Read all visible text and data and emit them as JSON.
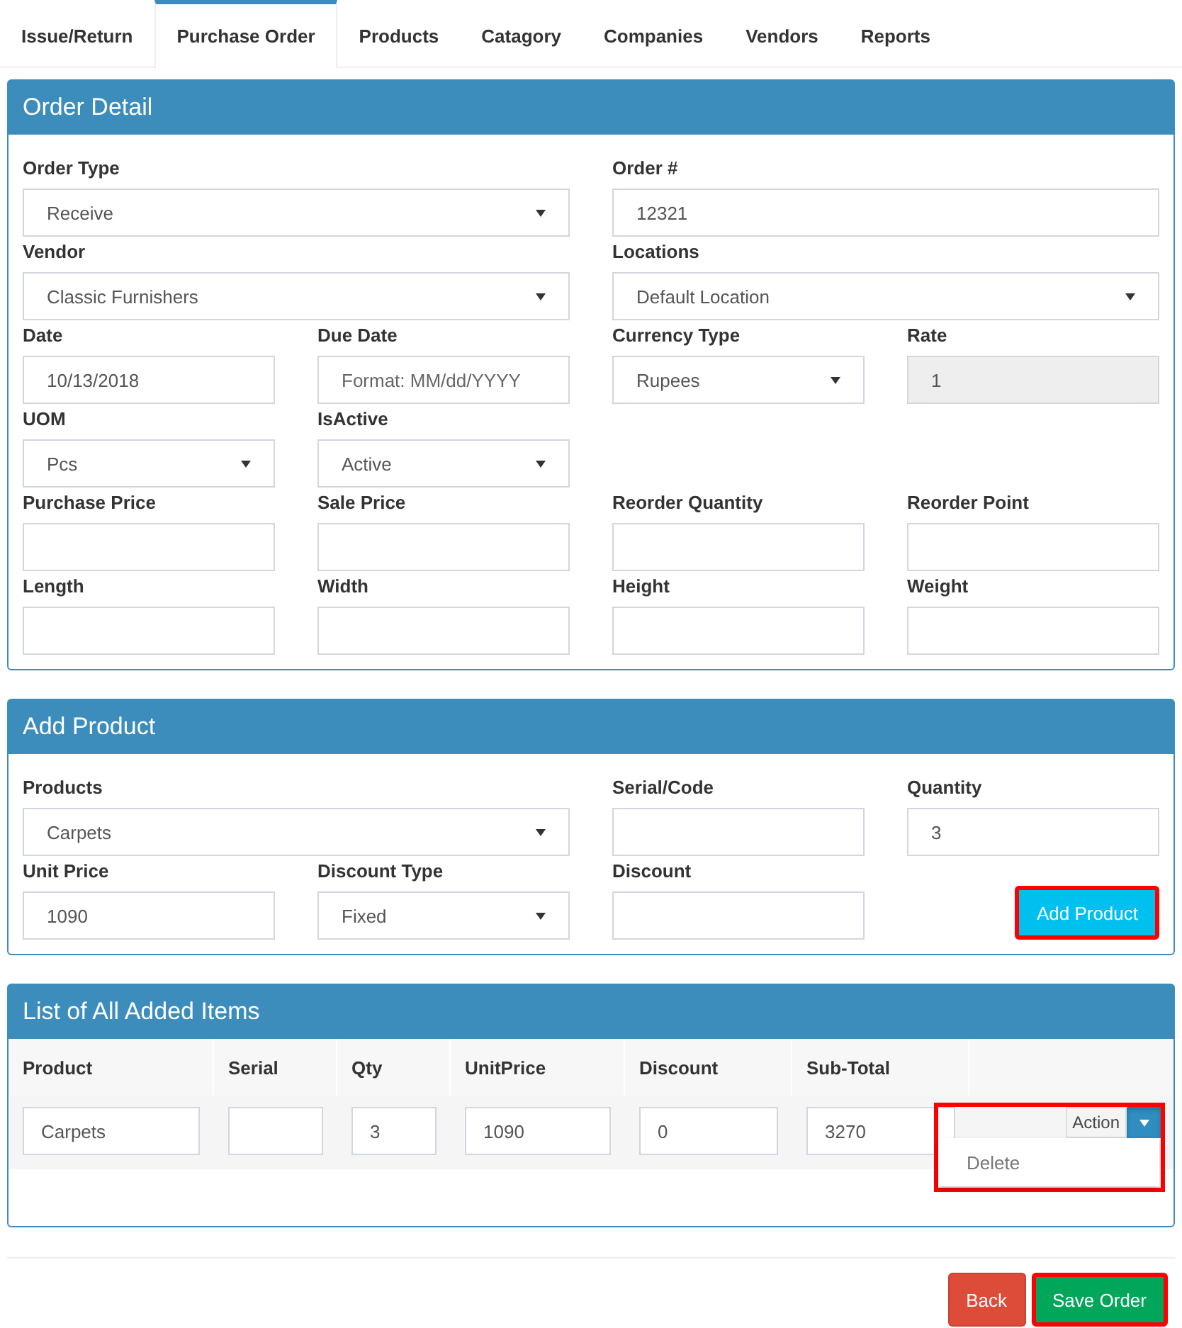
{
  "tabs": [
    {
      "label": "Issue/Return",
      "selected": false
    },
    {
      "label": "Purchase Order",
      "selected": true
    },
    {
      "label": "Products",
      "selected": false
    },
    {
      "label": "Catagory",
      "selected": false
    },
    {
      "label": "Companies",
      "selected": false
    },
    {
      "label": "Vendors",
      "selected": false
    },
    {
      "label": "Reports",
      "selected": false
    }
  ],
  "order_detail": {
    "title": "Order Detail",
    "rows": [
      [
        {
          "label": "Order Type",
          "kind": "select",
          "value": "Receive"
        },
        "",
        {
          "label": "Order #",
          "kind": "text",
          "value": "12321"
        },
        ""
      ],
      [
        {
          "label": "Vendor",
          "kind": "select",
          "value": "Classic Furnishers"
        },
        "",
        {
          "label": "Locations",
          "kind": "select",
          "value": "Default Location"
        },
        ""
      ],
      [
        {
          "label": "Date",
          "kind": "text",
          "value": "10/13/2018"
        },
        {
          "label": "Due Date",
          "kind": "text",
          "placeholder": "Format: MM/dd/YYYY"
        },
        {
          "label": "Currency Type",
          "kind": "select",
          "value": "Rupees"
        },
        {
          "label": "Rate",
          "kind": "text",
          "value": "1",
          "disabled": true
        }
      ],
      [
        {
          "label": "UOM",
          "kind": "select",
          "value": "Pcs"
        },
        {
          "label": "IsActive",
          "kind": "select",
          "value": "Active"
        }
      ],
      [
        {
          "label": "Purchase Price",
          "kind": "text"
        },
        {
          "label": "Sale Price",
          "kind": "text"
        },
        {
          "label": "Reorder Quantity",
          "kind": "text"
        },
        {
          "label": "Reorder Point",
          "kind": "text"
        }
      ],
      [
        {
          "label": "Length",
          "kind": "text"
        },
        {
          "label": "Width",
          "kind": "text"
        },
        {
          "label": "Height",
          "kind": "text"
        },
        {
          "label": "Weight",
          "kind": "text"
        }
      ]
    ]
  },
  "add_product": {
    "title": "Add Product",
    "rows": [
      [
        {
          "label": "Products",
          "kind": "select",
          "value": "Carpets"
        },
        "",
        {
          "label": "Serial/Code",
          "kind": "text"
        },
        {
          "label": "Quantity",
          "kind": "text",
          "value": "3"
        }
      ],
      [
        {
          "label": "Unit Price",
          "kind": "text",
          "value": "1090"
        },
        {
          "label": "Discount Type",
          "kind": "select",
          "value": "Fixed"
        },
        {
          "label": "Discount",
          "kind": "text"
        },
        {
          "label": "Add Product",
          "kind": "button",
          "highlighted": true
        }
      ]
    ]
  },
  "items": {
    "title": "List of All Added Items",
    "columns": [
      "Product",
      "Serial",
      "Qty",
      "UnitPrice",
      "Discount",
      "Sub-Total"
    ],
    "rows": [
      {
        "cells": [
          "Carpets",
          "",
          "3",
          "1090",
          "0",
          "3270"
        ],
        "action": {
          "label": "Action",
          "menu": [
            "Delete"
          ],
          "expanded": true,
          "highlighted": true
        }
      }
    ]
  },
  "footer": {
    "buttons": [
      {
        "label": "Back",
        "kind": "danger",
        "highlighted": false
      },
      {
        "label": "Save Order",
        "kind": "success",
        "highlighted": true
      }
    ]
  }
}
